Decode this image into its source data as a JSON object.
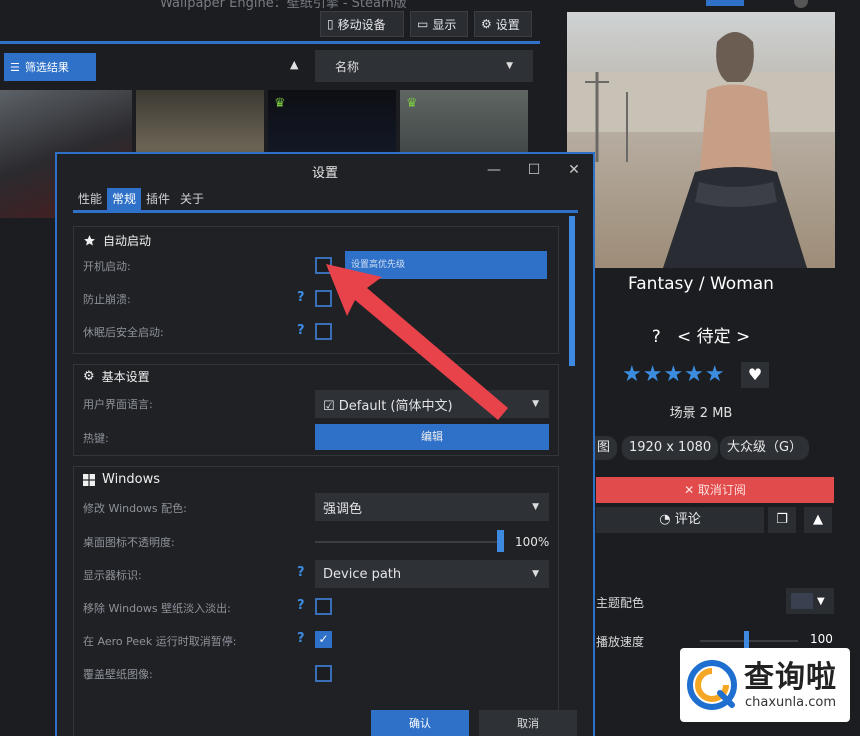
{
  "app": {
    "title": "Wallpaper Engine：壁纸引擎 - Steam版",
    "top_buttons": [
      "移动设备",
      "显示",
      "设置"
    ],
    "filter_label": "筛选结果",
    "sort_value": "名称"
  },
  "item": {
    "title": "Fantasy / Woman",
    "rating_prefix": "?",
    "rating_label": "< 待定 >",
    "stars": "★★★★★",
    "size": "场景 2 MB",
    "tags": [
      "图",
      "1920 x 1080",
      "大众级（G）"
    ],
    "unsubscribe": "✕ 取消订阅",
    "comment": "评论",
    "theme_color_label": "主题配色",
    "speed_label": "播放速度",
    "speed_value": "100",
    "colors": {
      "accent": "#2f71c8",
      "danger": "#e24b4b"
    }
  },
  "dialog": {
    "title": "设置",
    "tabs": [
      "性能",
      "常规",
      "插件",
      "关于"
    ],
    "active_tab": "常规",
    "sections": {
      "autostart": {
        "title": "自动启动",
        "rows": [
          {
            "label": "开机启动:",
            "checked": false,
            "extra": "设置高优先级"
          },
          {
            "label": "防止崩溃:",
            "checked": false
          },
          {
            "label": "休眠后安全启动:",
            "checked": false
          }
        ]
      },
      "basic": {
        "title": "基本设置",
        "language_label": "用户界面语言:",
        "language_value": "Default (简体中文)",
        "hotkey_label": "热键:",
        "hotkey_button": "编辑"
      },
      "windows": {
        "title": "Windows",
        "color_label": "修改 Windows 配色:",
        "color_value": "强调色",
        "opacity_label": "桌面图标不透明度:",
        "opacity_value": "100%",
        "opacity": 1.0,
        "monitor_label": "显示器标识:",
        "monitor_value": "Device path",
        "fade_label": "移除 Windows 壁纸淡入淡出:",
        "fade_checked": false,
        "aero_label": "在 Aero Peek 运行时取消暂停:",
        "aero_checked": true,
        "overlay_label": "覆盖壁纸图像:",
        "overlay_checked": false
      }
    },
    "ok": "确认",
    "cancel": "取消"
  },
  "watermark": {
    "text": "查询啦",
    "url": "chaxunla.com"
  }
}
